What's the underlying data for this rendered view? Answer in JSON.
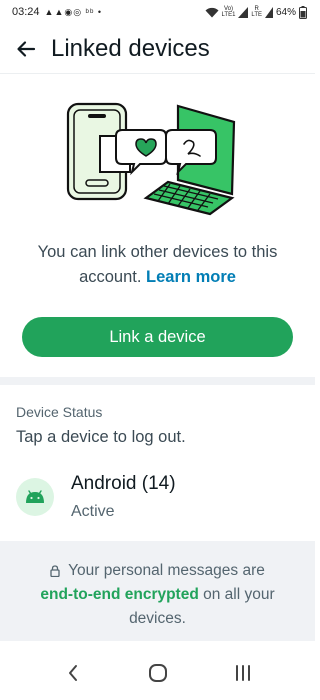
{
  "status_bar": {
    "time": "03:24",
    "left_icons_text": "▲▲◉◎ ᵇᵇ •",
    "volte_line1": "Vo)",
    "volte_line2": "LTE1",
    "signal_line1": "R",
    "signal_line2": "LTE",
    "battery": "64%"
  },
  "app_bar": {
    "title": "Linked devices"
  },
  "intro": {
    "text": "You can link other devices to this account.",
    "learn_more": "Learn more"
  },
  "link_button": {
    "label": "Link a device"
  },
  "devices_section": {
    "heading": "Device Status",
    "hint": "Tap a device to log out.",
    "device": {
      "name": "Android (14)",
      "status": "Active",
      "icon": "android-icon"
    }
  },
  "footer": {
    "line1": "Your personal messages are",
    "encrypted": "end-to-end encrypted",
    "line2_rest": " on all your",
    "line3": "devices."
  },
  "colors": {
    "accent": "#21a35b",
    "link": "#027eb5",
    "background_band": "#f0f2f5"
  }
}
